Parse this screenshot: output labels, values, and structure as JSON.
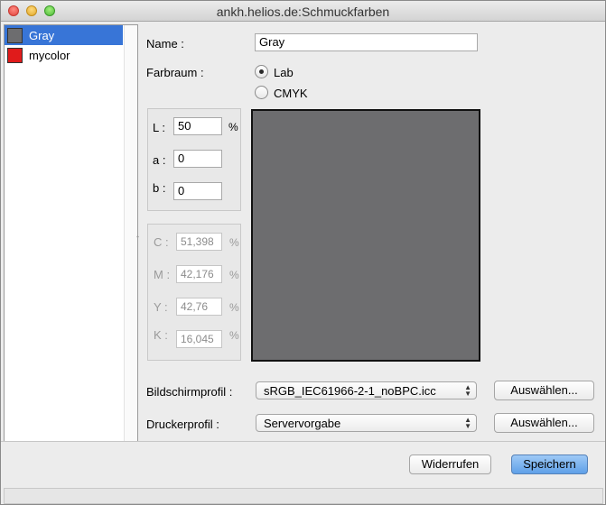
{
  "window": {
    "title": "ankh.helios.de:Schmuckfarben"
  },
  "colors": {
    "accent": "#3875d7",
    "gray_swatch": "#6d6d6f",
    "mycolor_swatch": "#e01b1b",
    "preview_fill": "#6d6d6f"
  },
  "sidebar": {
    "items": [
      {
        "label": "Gray",
        "selected": true
      },
      {
        "label": "mycolor",
        "selected": false
      }
    ]
  },
  "form": {
    "name_label": "Name :",
    "name_value": "Gray",
    "colorspace_label": "Farbraum :",
    "options": [
      {
        "label": "Lab",
        "checked": true
      },
      {
        "label": "CMYK",
        "checked": false
      }
    ]
  },
  "lab": {
    "l_label": "L :",
    "l_value": "50",
    "l_unit": "%",
    "a_label": "a :",
    "a_value": "0",
    "b_label": "b :",
    "b_value": "0"
  },
  "cmyk": {
    "c_label": "C :",
    "c_value": "51,398",
    "c_unit": "%",
    "m_label": "M :",
    "m_value": "42,176",
    "m_unit": "%",
    "y_label": "Y :",
    "y_value": "42,76",
    "y_unit": "%",
    "k_label": "K :",
    "k_value": "16,045",
    "k_unit": "%"
  },
  "profiles": {
    "screen_label": "Bildschirmprofil :",
    "screen_value": "sRGB_IEC61966-2-1_noBPC.icc",
    "printer_label": "Druckerprofil :",
    "printer_value": "Servervorgabe",
    "choose_label": "Auswählen..."
  },
  "footer": {
    "revert_label": "Widerrufen",
    "save_label": "Speichern"
  }
}
